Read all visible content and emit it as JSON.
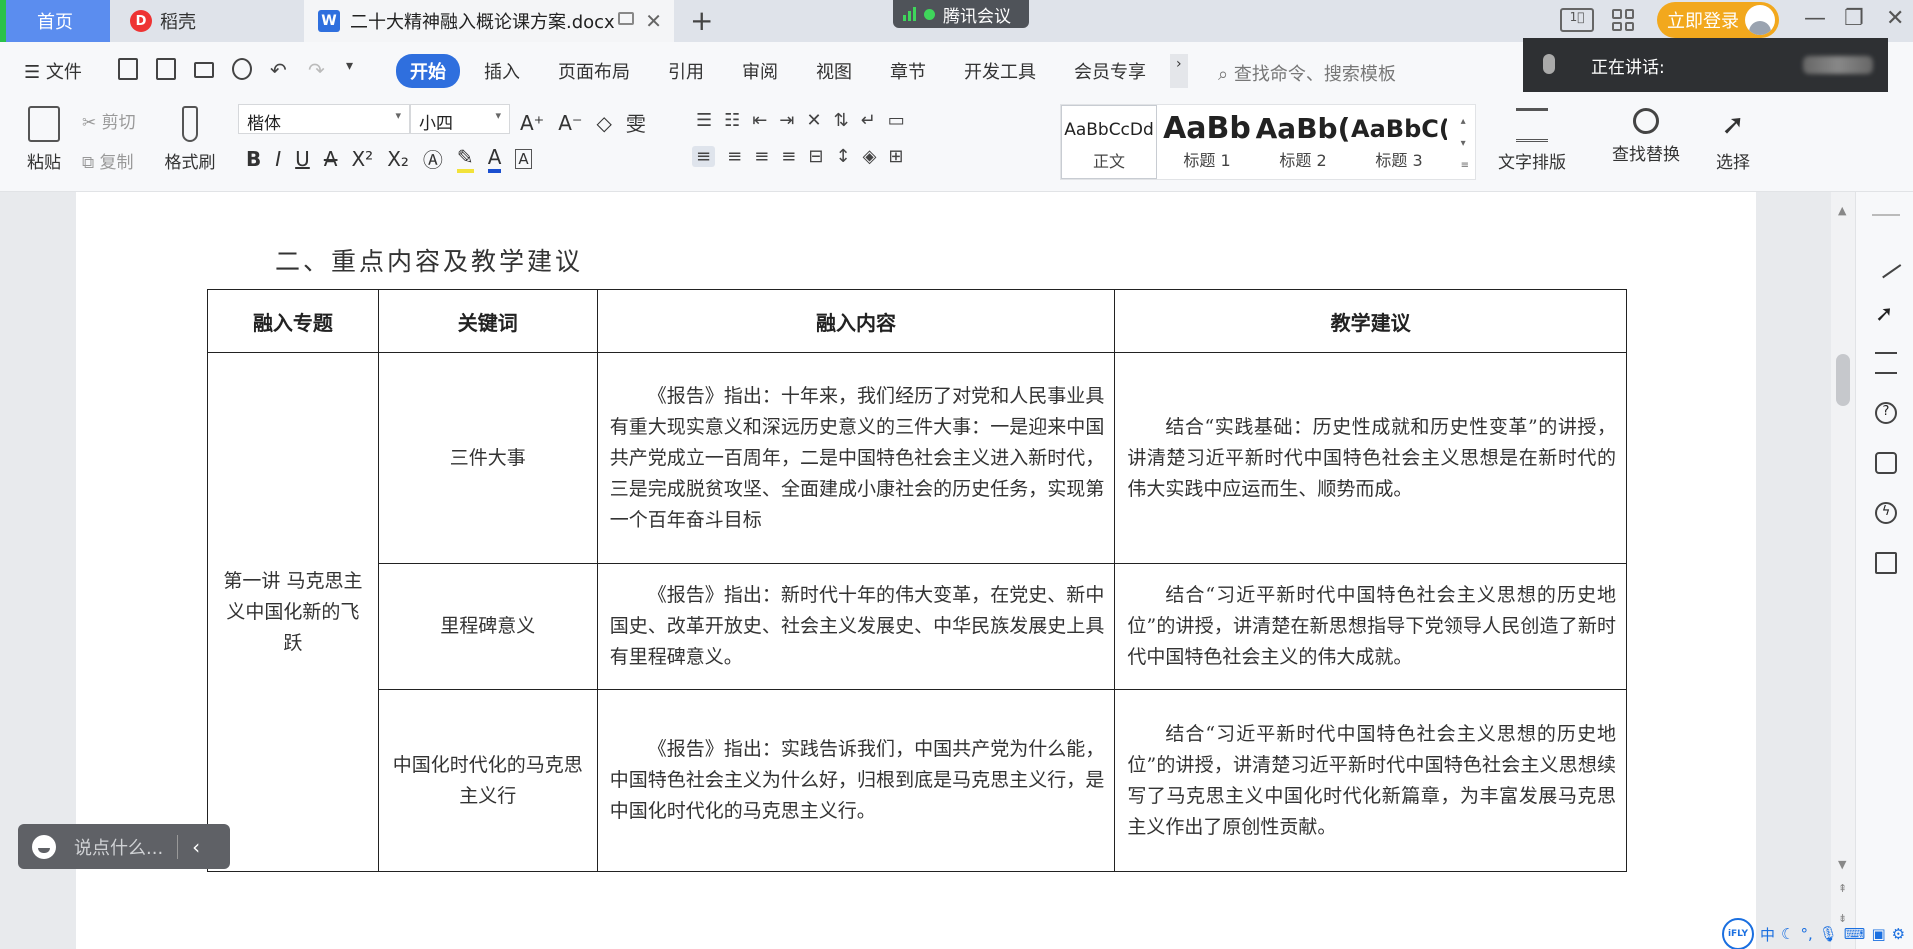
{
  "tabs": {
    "home": "首页",
    "daoke": "稻壳",
    "document": "二十大精神融入概论课方案.docx"
  },
  "meeting": {
    "label": "腾讯会议",
    "speaking": "正在讲话:"
  },
  "header": {
    "login": "立即登录"
  },
  "menu": {
    "file": "文件",
    "tabs": [
      "开始",
      "插入",
      "页面布局",
      "引用",
      "审阅",
      "视图",
      "章节",
      "开发工具",
      "会员专享"
    ],
    "search_placeholder": "查找命令、搜索模板"
  },
  "toolbar": {
    "paste": "粘贴",
    "cut": "剪切",
    "copy": "复制",
    "format_painter": "格式刷",
    "font_name": "楷体",
    "font_size": "小四",
    "styles": [
      {
        "sample": "AaBbCcDd",
        "name": "正文"
      },
      {
        "sample": "AaBb",
        "name": "标题 1"
      },
      {
        "sample": "AaBb(",
        "name": "标题 2"
      },
      {
        "sample": "AaBbC(",
        "name": "标题 3"
      }
    ],
    "text_layout": "文字排版",
    "find_replace": "查找替换",
    "select": "选择"
  },
  "document": {
    "section_title": "二、重点内容及教学建议",
    "table": {
      "headers": [
        "融入专题",
        "关键词",
        "融入内容",
        "教学建议"
      ],
      "topic": "第一讲 马克思主义中国化新的飞跃",
      "rows": [
        {
          "keyword": "三件大事",
          "content": "《报告》指出：十年来，我们经历了对党和人民事业具有重大现实意义和深远历史意义的三件大事：一是迎来中国共产党成立一百周年，二是中国特色社会主义进入新时代，三是完成脱贫攻坚、全面建成小康社会的历史任务，实现第一个百年奋斗目标",
          "suggestion": "结合“实践基础：历史性成就和历史性变革”的讲授，讲清楚习近平新时代中国特色社会主义思想是在新时代的伟大实践中应运而生、顺势而成。"
        },
        {
          "keyword": "里程碑意义",
          "content": "《报告》指出：新时代十年的伟大变革，在党史、新中国史、改革开放史、社会主义发展史、中华民族发展史上具有里程碑意义。",
          "suggestion": "结合“习近平新时代中国特色社会主义思想的历史地位”的讲授，讲清楚在新思想指导下党领导人民创造了新时代中国特色社会主义的伟大成就。"
        },
        {
          "keyword": "中国化时代化的马克思主义行",
          "content": "《报告》指出：实践告诉我们，中国共产党为什么能，中国特色社会主义为什么好，归根到底是马克思主义行，是中国化时代化的马克思主义行。",
          "suggestion": "结合“习近平新时代中国特色社会主义思想的历史地位”的讲授，讲清楚习近平新时代中国特色社会主义思想续写了马克思主义中国化时代化新篇章，为丰富发展马克思主义作出了原创性贡献。"
        }
      ]
    }
  },
  "chat": {
    "placeholder": "说点什么..."
  },
  "ime": {
    "lang": "中"
  }
}
